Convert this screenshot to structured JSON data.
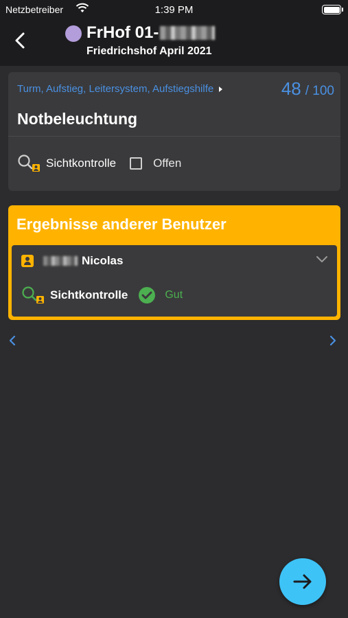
{
  "status_bar": {
    "carrier": "Netzbetreiber",
    "time": "1:39 PM"
  },
  "header": {
    "title": "FrHof 01-",
    "subtitle": "Friedrichshof April 2021",
    "dot_color": "#b39ddb"
  },
  "card": {
    "breadcrumb": "Turm, Aufstieg, Leitersystem, Aufstiegshilfe",
    "counter_current": "48",
    "counter_total": "/ 100",
    "item_title": "Notbeleuchtung",
    "method_label": "Sichtkontrolle",
    "checkbox_label": "Offen",
    "checkbox_checked": false
  },
  "others": {
    "title": "Ergebnisse anderer Benutzer",
    "user_name": "Nicolas",
    "result_method": "Sichtkontrolle",
    "result_status": "Gut",
    "accent_color": "#ffb300",
    "status_color": "#4caf50"
  },
  "icons": {
    "back": "chevron-left-icon",
    "method": "magnifier-person-icon",
    "user": "person-badge-icon",
    "expand": "chevron-down-icon",
    "status": "check-circle-icon",
    "prev": "chevron-left-icon",
    "next": "chevron-right-icon",
    "fab": "arrow-right-icon"
  },
  "colors": {
    "link": "#4a90e2",
    "fab": "#3ec3f7",
    "background": "#2c2c2e",
    "card": "#3a3a3c"
  }
}
